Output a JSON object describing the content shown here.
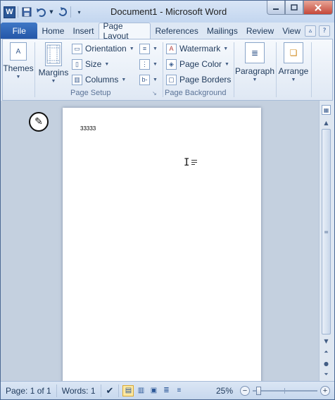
{
  "window": {
    "title": "Document1 - Microsoft Word",
    "app_icon_letter": "W"
  },
  "tabs": {
    "file": "File",
    "items": [
      {
        "label": "Home",
        "active": false
      },
      {
        "label": "Insert",
        "active": false
      },
      {
        "label": "Page Layout",
        "active": true
      },
      {
        "label": "References",
        "active": false
      },
      {
        "label": "Mailings",
        "active": false
      },
      {
        "label": "Review",
        "active": false
      },
      {
        "label": "View",
        "active": false
      }
    ]
  },
  "ribbon": {
    "themes": "Themes",
    "margins": "Margins",
    "orientation": "Orientation",
    "size": "Size",
    "columns": "Columns",
    "page_setup_label": "Page Setup",
    "watermark": "Watermark",
    "page_color": "Page Color",
    "page_borders": "Page Borders",
    "page_background_label": "Page Background",
    "paragraph": "Paragraph",
    "arrange": "Arrange"
  },
  "document": {
    "text": "33333"
  },
  "status": {
    "page": "Page: 1 of 1",
    "words": "Words: 1",
    "zoom": "25%",
    "zoom_fraction": 0.25
  },
  "colors": {
    "file_tab": "#2b5797",
    "accent": "#1e395b",
    "active_view": "#fde8a0"
  }
}
